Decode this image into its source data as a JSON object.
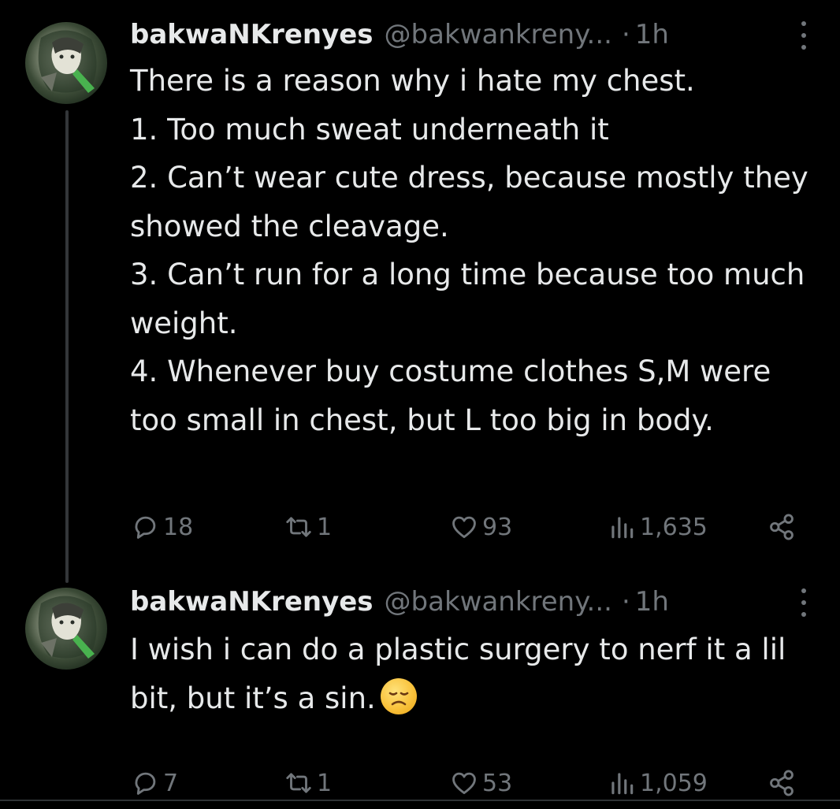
{
  "tweets": [
    {
      "display_name": "bakwaNKrenyes",
      "handle": "@bakwankreny...",
      "dot": "·",
      "time": "1h",
      "text": "There is a reason why i hate my chest.\n1. Too much sweat underneath it\n2. Can’t wear cute dress, because mostly they showed the cleavage.\n3. Can’t run for a long time because too much weight.\n4. Whenever buy costume clothes S,M were too small in chest, but L too big in body.",
      "replies": "18",
      "reposts": "1",
      "likes": "93",
      "views": "1,635"
    },
    {
      "display_name": "bakwaNKrenyes",
      "handle": "@bakwankreny...",
      "dot": "·",
      "time": "1h",
      "text": "I wish i can do a plastic surgery to nerf it a lil bit, but it’s a sin.",
      "emoji": "disappointed-face-emoji",
      "replies": "7",
      "reposts": "1",
      "likes": "53",
      "views": "1,059"
    }
  ],
  "icons": {
    "reply": "reply-icon",
    "repost": "repost-icon",
    "like": "heart-icon",
    "views": "views-icon",
    "share": "share-icon",
    "more": "more-icon"
  },
  "colors": {
    "background": "#000000",
    "text": "#e7e9ea",
    "secondary": "#71767b",
    "thread_line": "#333639"
  }
}
